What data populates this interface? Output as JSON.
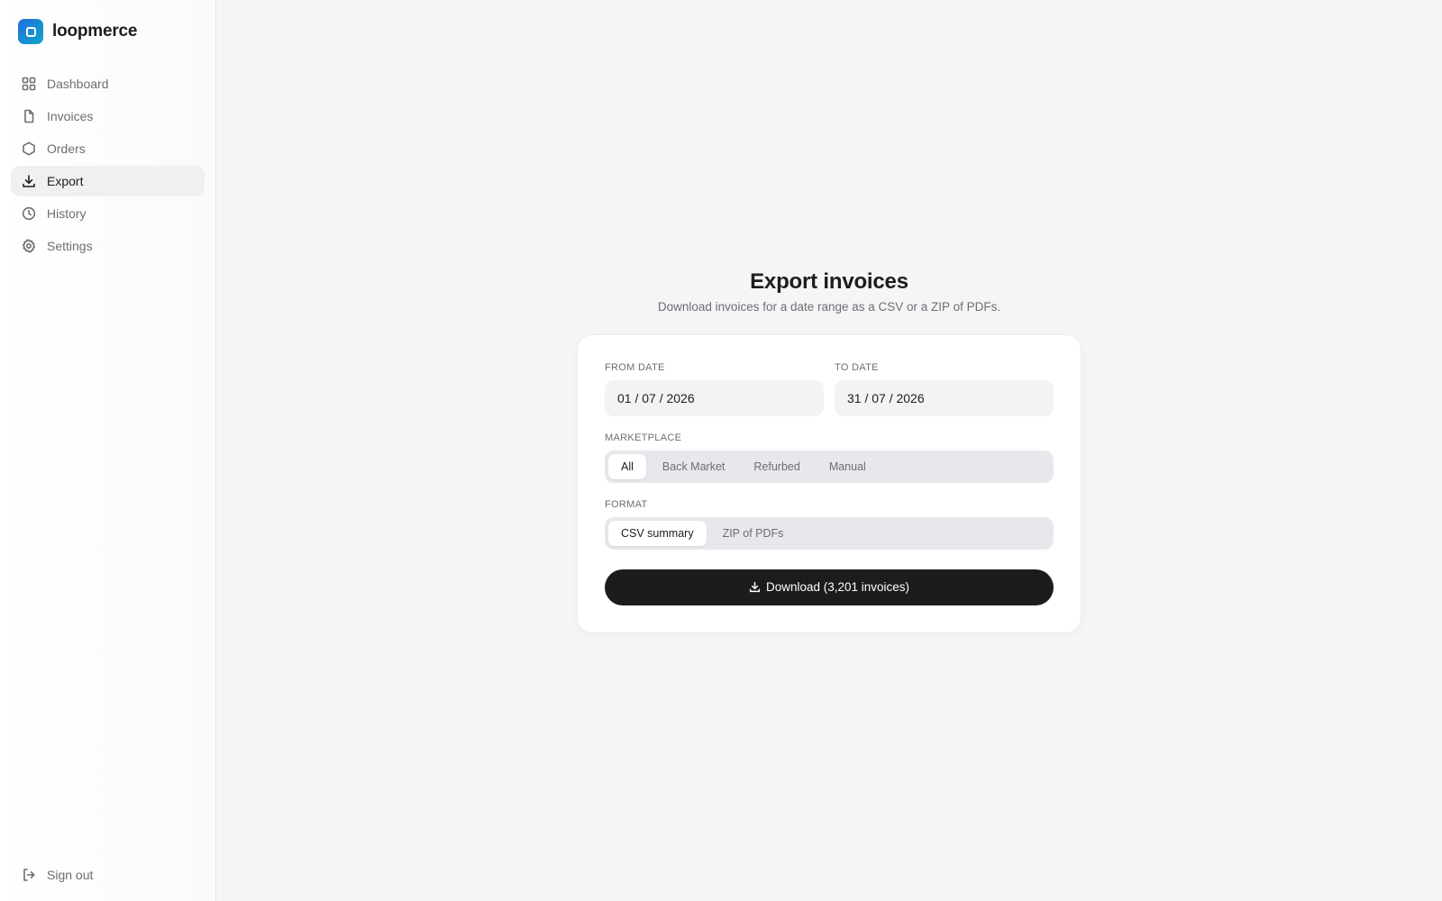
{
  "brand": {
    "name": "loopmerce",
    "accent_start": "#1f6fe0",
    "accent_end": "#12a6c8"
  },
  "sidebar": {
    "items": [
      {
        "label": "Dashboard",
        "icon": "grid-icon"
      },
      {
        "label": "Invoices",
        "icon": "file-icon"
      },
      {
        "label": "Orders",
        "icon": "box-icon"
      },
      {
        "label": "Export",
        "icon": "download-icon",
        "active": true
      },
      {
        "label": "History",
        "icon": "clock-icon"
      },
      {
        "label": "Settings",
        "icon": "gear-icon"
      }
    ],
    "signout_label": "Sign out"
  },
  "main": {
    "title": "Export invoices",
    "subtitle": "Download invoices for a date range as a CSV or a ZIP of PDFs.",
    "from_date": {
      "label": "From date",
      "value": "01 / 07 / 2026"
    },
    "to_date": {
      "label": "To date",
      "value": "31 / 07 / 2026"
    },
    "marketplace": {
      "label": "Marketplace",
      "options": [
        "All",
        "Back Market",
        "Refurbed",
        "Manual"
      ],
      "selected": "All"
    },
    "format": {
      "label": "Format",
      "options": [
        "CSV summary",
        "ZIP of PDFs"
      ],
      "selected": "CSV summary"
    },
    "download_label": "Download (3,201 invoices)"
  }
}
